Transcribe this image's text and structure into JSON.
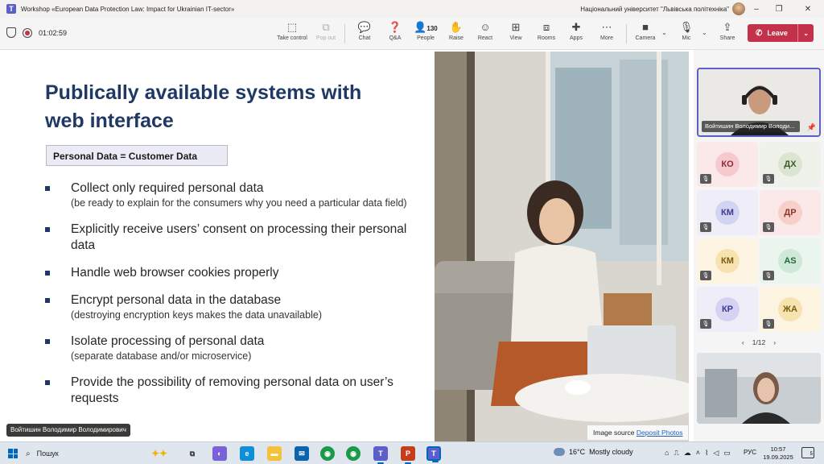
{
  "window": {
    "title": "Workshop «European Data Protection Law: Impact for Ukrainian IT-sector»",
    "org": "Національний університет \"Львівська політехніка\"",
    "controls": {
      "minimize": "–",
      "restore": "❐",
      "close": "✕"
    }
  },
  "meeting": {
    "timer": "01:02:59",
    "toolbar": {
      "take_control": "Take control",
      "pop_out": "Pop out",
      "chat": "Chat",
      "qa": "Q&A",
      "people": "People",
      "people_count": "130",
      "raise": "Raise",
      "react": "React",
      "view": "View",
      "rooms": "Rooms",
      "apps": "Apps",
      "more": "More",
      "camera": "Camera",
      "mic": "Mic",
      "share": "Share",
      "leave": "Leave"
    }
  },
  "slide": {
    "title": "Publically available systems with web interface",
    "box": "Personal Data = Customer Data",
    "bullets": [
      {
        "main": "Collect only required personal data",
        "sub": "(be ready to explain for the consumers why you need a particular data field)"
      },
      {
        "main": "Explicitly receive users’ consent on processing their personal data",
        "sub": ""
      },
      {
        "main": "Handle web browser cookies properly",
        "sub": ""
      },
      {
        "main": "Encrypt personal data in the database",
        "sub": "(destroying encryption keys makes the data unavailable)"
      },
      {
        "main": "Isolate processing of personal data",
        "sub": "(separate database and/or microservice)"
      },
      {
        "main": "Provide the possibility of removing personal data on user’s requests",
        "sub": ""
      }
    ],
    "image_source_label": "Image source",
    "image_source_link": "Deposit Photos"
  },
  "presenter_label": "Войтишин Володимир Володимирович",
  "participants": {
    "main_video_name": "Войтишин Володимир Володи...",
    "tiles": [
      {
        "initials": "КО",
        "bg": "#fbe9ea",
        "avatar_bg": "#f6c9cf",
        "color": "#8c2b3a"
      },
      {
        "initials": "ДХ",
        "bg": "#eef2ea",
        "avatar_bg": "#dbe5d2",
        "color": "#3b5a2a"
      },
      {
        "initials": "КМ",
        "bg": "#eeedf8",
        "avatar_bg": "#d5d3f2",
        "color": "#3c3a8c"
      },
      {
        "initials": "ДР",
        "bg": "#fbe9ea",
        "avatar_bg": "#f6d0c9",
        "color": "#8c3b2b"
      },
      {
        "initials": "КМ",
        "bg": "#fdf5e2",
        "avatar_bg": "#f7e3b0",
        "color": "#7a5a10"
      },
      {
        "initials": "AS",
        "bg": "#eaf5ee",
        "avatar_bg": "#cfe9d8",
        "color": "#246a40"
      },
      {
        "initials": "КР",
        "bg": "#eeedf8",
        "avatar_bg": "#d5d3f2",
        "color": "#3c3a8c"
      },
      {
        "initials": "ЖА",
        "bg": "#fdf5e2",
        "avatar_bg": "#f7e3b0",
        "color": "#7a5a10"
      }
    ],
    "pager": {
      "prev": "‹",
      "label": "1/12",
      "next": "›"
    }
  },
  "taskbar": {
    "search": "Пошук",
    "weather_temp": "16°C",
    "weather_desc": "Mostly cloudy",
    "lang": "РУС",
    "time": "10:57",
    "date": "19.09.2025",
    "notifications": "5"
  }
}
